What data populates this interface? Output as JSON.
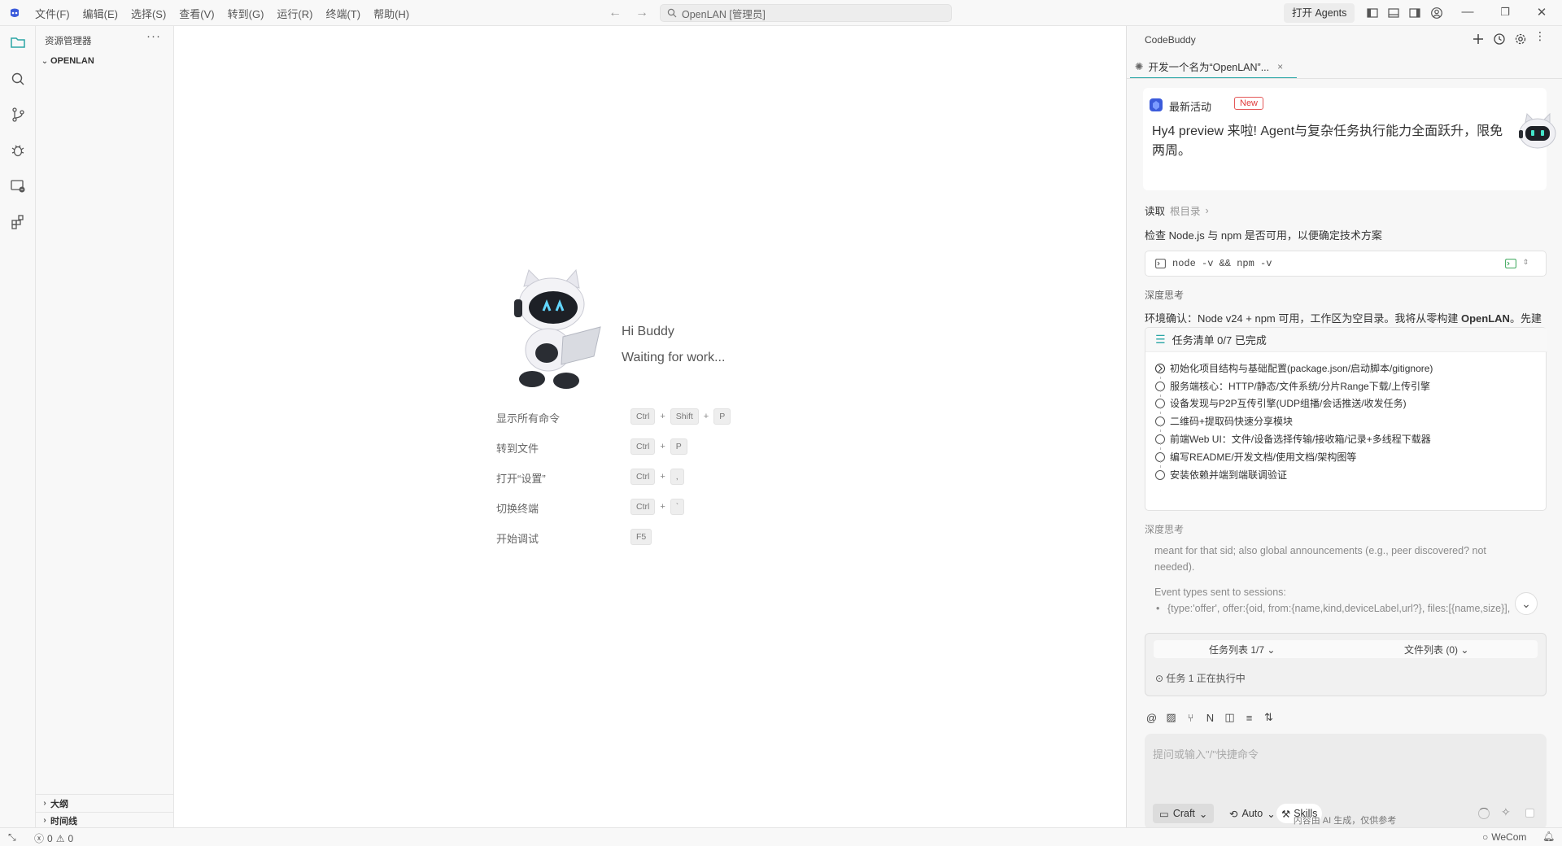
{
  "titlebar": {
    "menu": [
      "文件(F)",
      "编辑(E)",
      "选择(S)",
      "查看(V)",
      "转到(G)",
      "运行(R)",
      "终端(T)",
      "帮助(H)"
    ],
    "search_text": "OpenLAN [管理员]",
    "open_agents": "打开 Agents"
  },
  "sidebar": {
    "title": "资源管理器",
    "root_folder": "OPENLAN",
    "outline": "大纲",
    "timeline": "时间线"
  },
  "welcome": {
    "greeting": "Hi Buddy",
    "status": "Waiting for work...",
    "shortcuts": [
      {
        "label": "显示所有命令",
        "keys": [
          "Ctrl",
          "Shift",
          "P"
        ]
      },
      {
        "label": "转到文件",
        "keys": [
          "Ctrl",
          "P"
        ]
      },
      {
        "label": "打开“设置”",
        "keys": [
          "Ctrl",
          ","
        ]
      },
      {
        "label": "切换终端",
        "keys": [
          "Ctrl",
          "`"
        ]
      },
      {
        "label": "开始调试",
        "keys": [
          "F5"
        ]
      }
    ]
  },
  "panel": {
    "title": "CodeBuddy",
    "tab_label": "开发一个名为“OpenLAN”...",
    "news": {
      "title": "最新活动",
      "badge": "New",
      "text": "Hy4 preview 来啦! Agent与复杂任务执行能力全面跃升，限免两周。"
    },
    "read_label": "读取",
    "read_path": "根目录",
    "check_text": "检查 Node.js 与 npm 是否可用，以便确定技术方案",
    "command": "node -v && npm -v",
    "thinking_label": "深度思考",
    "env_text_a": "环境确认：Node v24 + npm 可用，工作区为空目录。我将从零构建 ",
    "env_text_bold": "OpenLAN",
    "env_text_b": "。先建立任务清单：",
    "task_list": {
      "title": "任务清单 0/7 已完成",
      "items": [
        "初始化项目结构与基础配置(package.json/启动脚本/gitignore)",
        "服务端核心：HTTP/静态/文件系统/分片Range下载/上传引擎",
        "设备发现与P2P互传引擎(UDP组播/会话推送/收发任务)",
        "二维码+提取码快速分享模块",
        "前端Web UI：文件/设备选择传输/接收箱/记录+多线程下载器",
        "编写README/开发文档/使用文档/架构图等",
        "安装依赖并端到端联调验证"
      ]
    },
    "thinking_label_2": "深度思考",
    "thinking_lines": [
      "meant for that sid; also global announcements (e.g., peer discovered? not",
      "needed).",
      "Event types sent to sessions:",
      "{type:'offer', offer:{oid, from:{name,kind,deviceLabel,url?}, files:[{name,size}],"
    ],
    "status": {
      "task_tab": "任务列表 1/7",
      "file_tab": "文件列表 (0)",
      "exec": "任务 1 正在执行中"
    },
    "input": {
      "placeholder": "提问或输入\"/\"快捷命令",
      "mode": "Craft",
      "model": "Auto",
      "skills": "Skills"
    },
    "ai_notice": "内容由 AI 生成，仅供参考"
  },
  "statusbar": {
    "errors": "0",
    "warnings": "0",
    "wecom": "WeCom"
  },
  "colors": {
    "accent": "#2aa6a6",
    "badge_red": "#e03c3c",
    "logo_blue": "#3b5bdb"
  }
}
